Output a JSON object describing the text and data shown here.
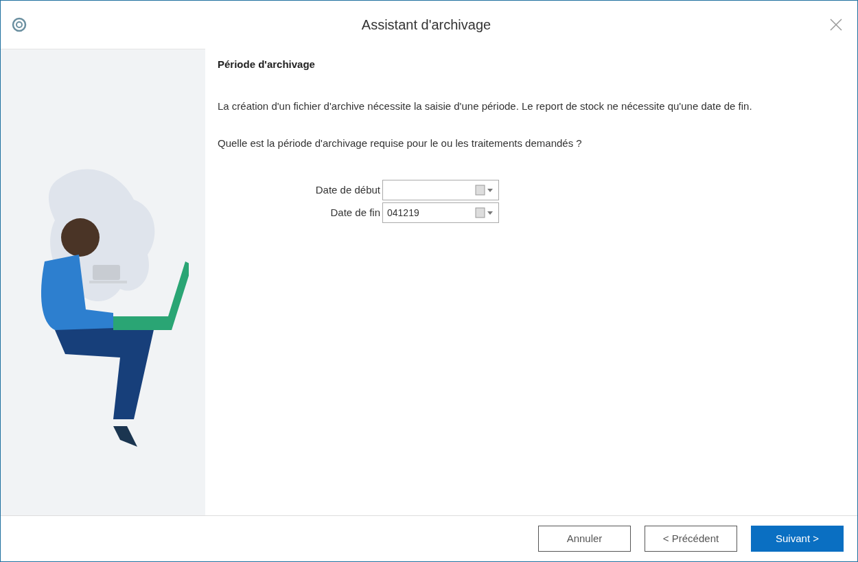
{
  "window": {
    "title": "Assistant d'archivage"
  },
  "step": {
    "heading": "Période d'archivage",
    "description": "La création d'un fichier d'archive nécessite la saisie d'une période. Le report de stock ne nécessite qu'une date de fin.",
    "question": "Quelle est la période d'archivage requise pour le ou les traitements demandés ?"
  },
  "fields": [
    {
      "label": "Date de début"
    },
    {
      "label": "Date de fin",
      "value": "041219"
    }
  ],
  "buttons": [
    {
      "label": "Annuler",
      "kind": "secondary"
    },
    {
      "label": "< Précédent",
      "kind": "secondary"
    },
    {
      "label": "Suivant >",
      "kind": "primary"
    }
  ]
}
